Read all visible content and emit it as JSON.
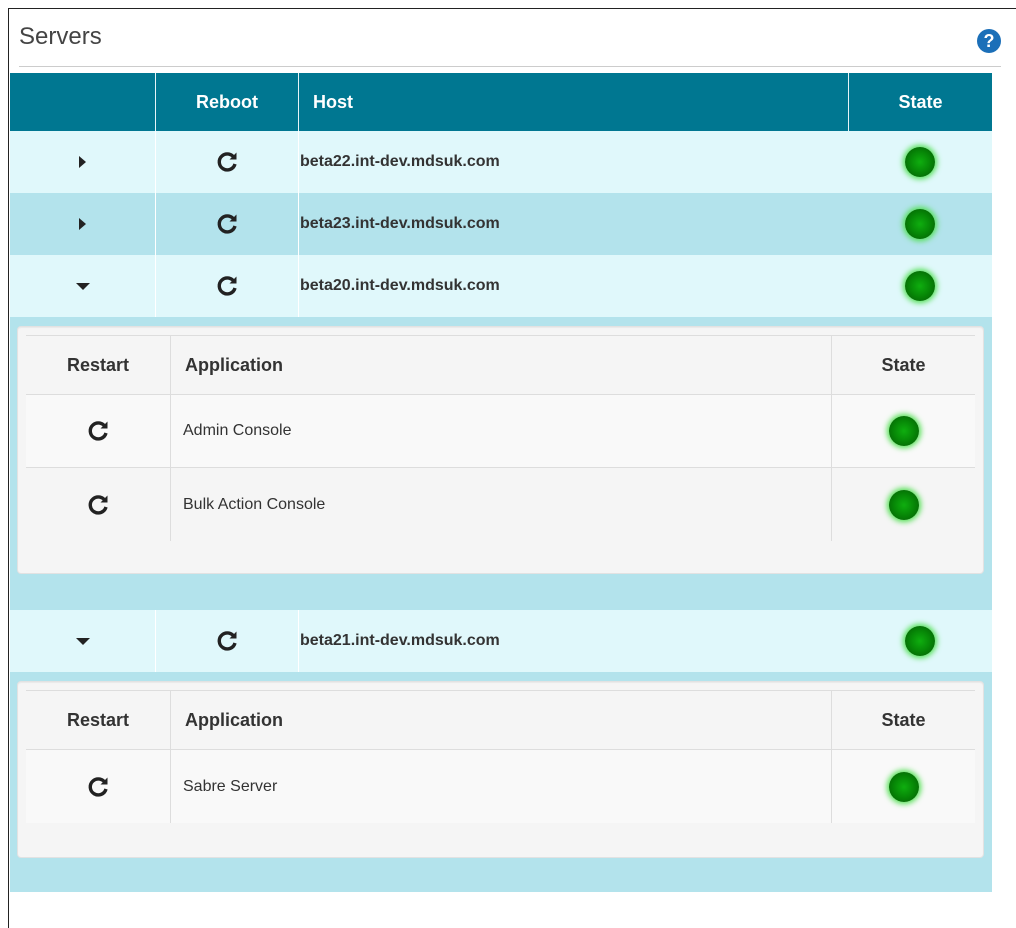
{
  "panel": {
    "title": "Servers",
    "help_icon": "question-circle-icon"
  },
  "servers_table": {
    "headers": {
      "toggle": "",
      "reboot": "Reboot",
      "host": "Host",
      "state": "State"
    },
    "rows": [
      {
        "host": "beta22.int-dev.mdsuk.com",
        "expanded": false,
        "state": "running"
      },
      {
        "host": "beta23.int-dev.mdsuk.com",
        "expanded": false,
        "state": "running"
      },
      {
        "host": "beta20.int-dev.mdsuk.com",
        "expanded": true,
        "state": "running"
      },
      {
        "host": "beta21.int-dev.mdsuk.com",
        "expanded": true,
        "state": "running"
      }
    ]
  },
  "applications": {
    "headers": {
      "restart": "Restart",
      "application": "Application",
      "state": "State"
    },
    "beta20": [
      {
        "name": "Admin Console",
        "state": "running"
      },
      {
        "name": "Bulk Action Console",
        "state": "running"
      }
    ],
    "beta21": [
      {
        "name": "Sabre Server",
        "state": "running"
      }
    ]
  },
  "colors": {
    "header_bg": "#007791",
    "row_light": "#e0f8fb",
    "row_dark": "#b3e3ec",
    "status_running": "#0a9a0a",
    "help_icon": "#1b6fb8"
  },
  "icons": {
    "collapsed": "caret-right-icon",
    "expanded": "caret-down-icon",
    "reboot": "refresh-icon",
    "state": "status-led-icon"
  }
}
